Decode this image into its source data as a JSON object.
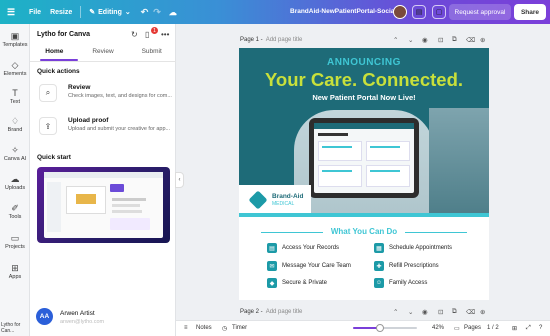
{
  "topbar": {
    "file": "File",
    "resize": "Resize",
    "editing": "Editing",
    "file_name": "BrandAid-NewPatientPortal-Social",
    "request_approval": "Request approval",
    "share": "Share"
  },
  "rail": {
    "items": [
      {
        "label": "Templates",
        "icon": "templates-icon"
      },
      {
        "label": "Elements",
        "icon": "elements-icon"
      },
      {
        "label": "Text",
        "icon": "text-icon"
      },
      {
        "label": "Brand",
        "icon": "brand-icon"
      },
      {
        "label": "Canva AI",
        "icon": "canva-ai-icon"
      },
      {
        "label": "Uploads",
        "icon": "uploads-icon"
      },
      {
        "label": "Tools",
        "icon": "tools-icon"
      },
      {
        "label": "Projects",
        "icon": "projects-icon"
      },
      {
        "label": "Apps",
        "icon": "apps-icon"
      }
    ],
    "bottom_label": "Lytho for Can..."
  },
  "panel": {
    "title": "Lytho for Canva",
    "notification_count": "1",
    "tabs": [
      "Home",
      "Review",
      "Submit"
    ],
    "quick_actions_title": "Quick actions",
    "actions": [
      {
        "title": "Review",
        "desc": "Check images, text, and designs for com..."
      },
      {
        "title": "Upload proof",
        "desc": "Upload and submit your creative for app..."
      }
    ],
    "quick_start_title": "Quick start",
    "user": {
      "initials": "AA",
      "name": "Arwen Artist",
      "email": "arwen@lytho.com"
    }
  },
  "canvas": {
    "page1_label": "Page 1 -",
    "page2_label": "Page 2 -",
    "add_title": "Add page title"
  },
  "design": {
    "announcing": "ANNOUNCING",
    "headline": "Your Care. Connected.",
    "subheadline": "New Patient Portal Now Live!",
    "logo_name": "Brand-Aid",
    "logo_sub": "MEDICAL",
    "what_you_can_do": "What You Can Do",
    "features": [
      "Access Your Records",
      "Schedule Appointments",
      "Message Your Care Team",
      "Refill Prescriptions",
      "Secure & Private",
      "Family Access"
    ],
    "colors": {
      "teal_dark": "#1e6b78",
      "teal_light": "#3fc6d4",
      "lime": "#c8e03b"
    }
  },
  "bottombar": {
    "notes": "Notes",
    "timer": "Timer",
    "zoom": "42%",
    "zoom_fraction": 0.42,
    "pages": "Pages",
    "page_count": "1 / 2"
  }
}
